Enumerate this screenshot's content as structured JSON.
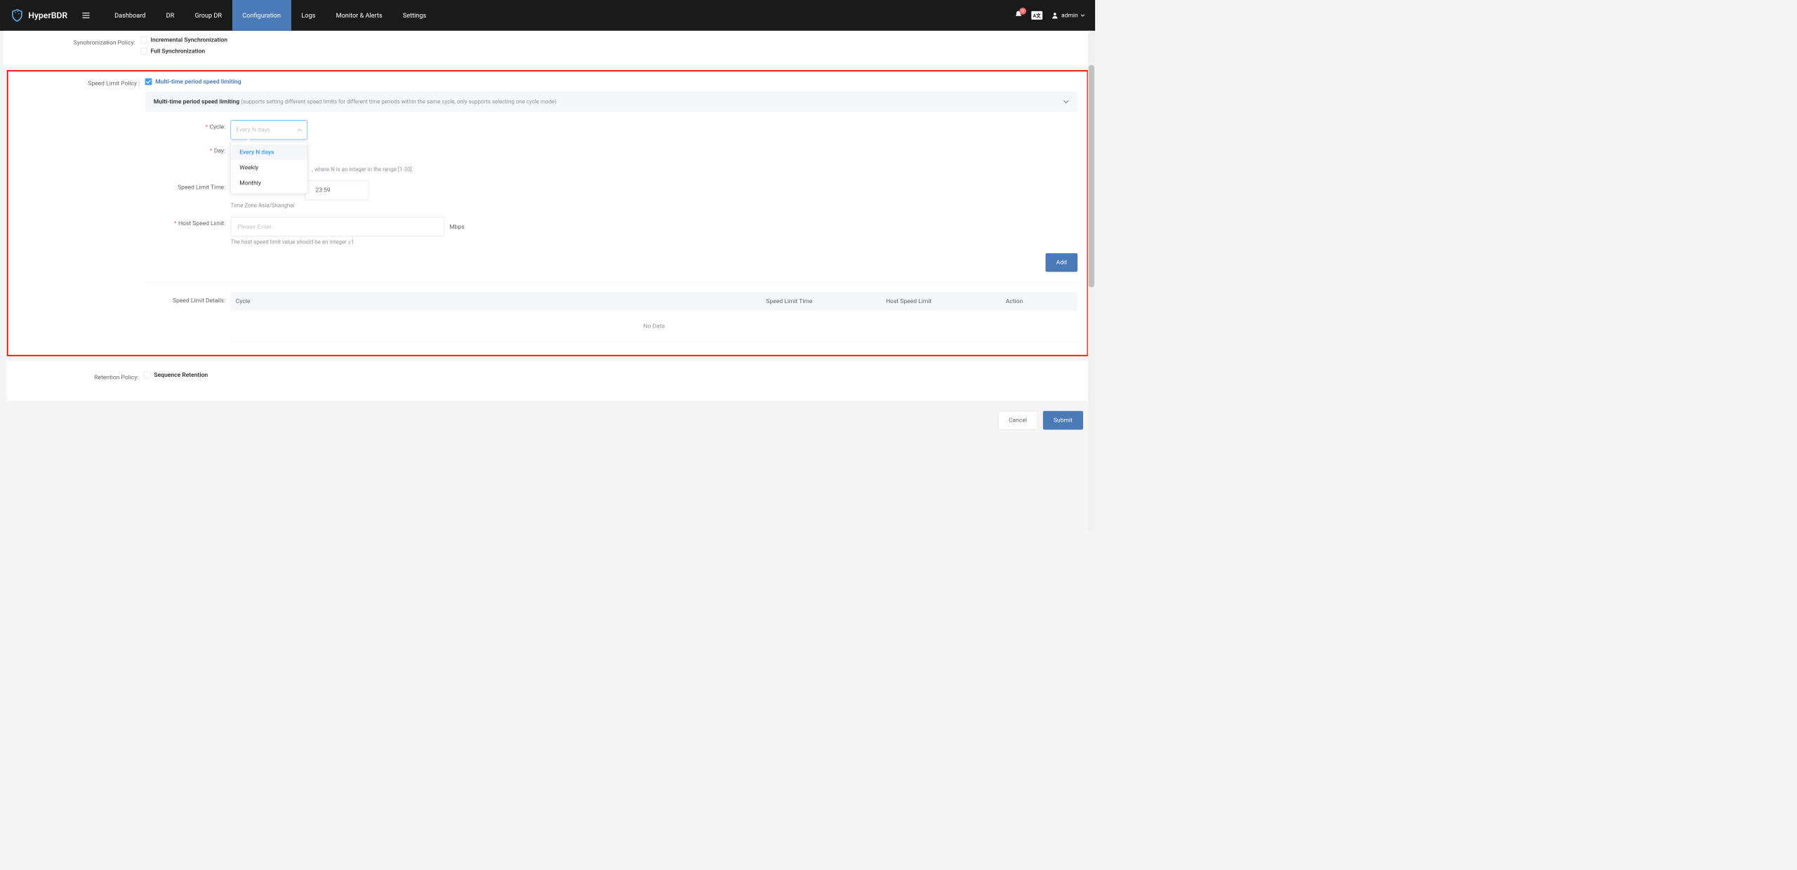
{
  "header": {
    "brand": "HyperBDR",
    "nav": [
      "Dashboard",
      "DR",
      "Group DR",
      "Configuration",
      "Logs",
      "Monitor & Alerts",
      "Settings"
    ],
    "activeNav": "Configuration",
    "bellCount": "0",
    "lang": "A文",
    "user": "admin"
  },
  "syncPolicy": {
    "label": "Synchronization Policy:",
    "opt1": "Incremental Synchronization",
    "opt2": "Full Synchronization"
  },
  "speedLimit": {
    "label": "Speed Limit Policy :",
    "checkboxLabel": "Multi-time period speed limiting",
    "collapseTitle": "Multi-time period speed limiting",
    "collapseSub": "(supports setting different speed limits for different time periods within the same cycle, only supports selecting one cycle mode)",
    "cycleLabel": "Cycle:",
    "cycleValue": "Every N days",
    "dropdown": [
      "Every N days",
      "Weekly",
      "Monthly"
    ],
    "dayLabel": "Day:",
    "dayHelp": ", where N is an integer in the range [1-30].",
    "timeLabel": "Speed Limit Time:",
    "timeEnd": "23:59",
    "timeHelp": "Time Zone Asia/Shanghai",
    "hostLabel": "Host Speed Limit:",
    "hostPlaceholder": "Please Enter",
    "hostUnit": "Mbps",
    "hostHelp": "The host speed limit value should be an integer ≥1.",
    "addBtn": "Add",
    "detailsLabel": "Speed Limit Details:",
    "cols": {
      "cycle": "Cycle",
      "time": "Speed Limit Time",
      "limit": "Host Speed Limit",
      "action": "Action"
    },
    "noData": "No Data"
  },
  "retention": {
    "label": "Retention Policy:",
    "opt": "Sequence Retention"
  },
  "footer": {
    "cancel": "Cancel",
    "submit": "Submit"
  }
}
